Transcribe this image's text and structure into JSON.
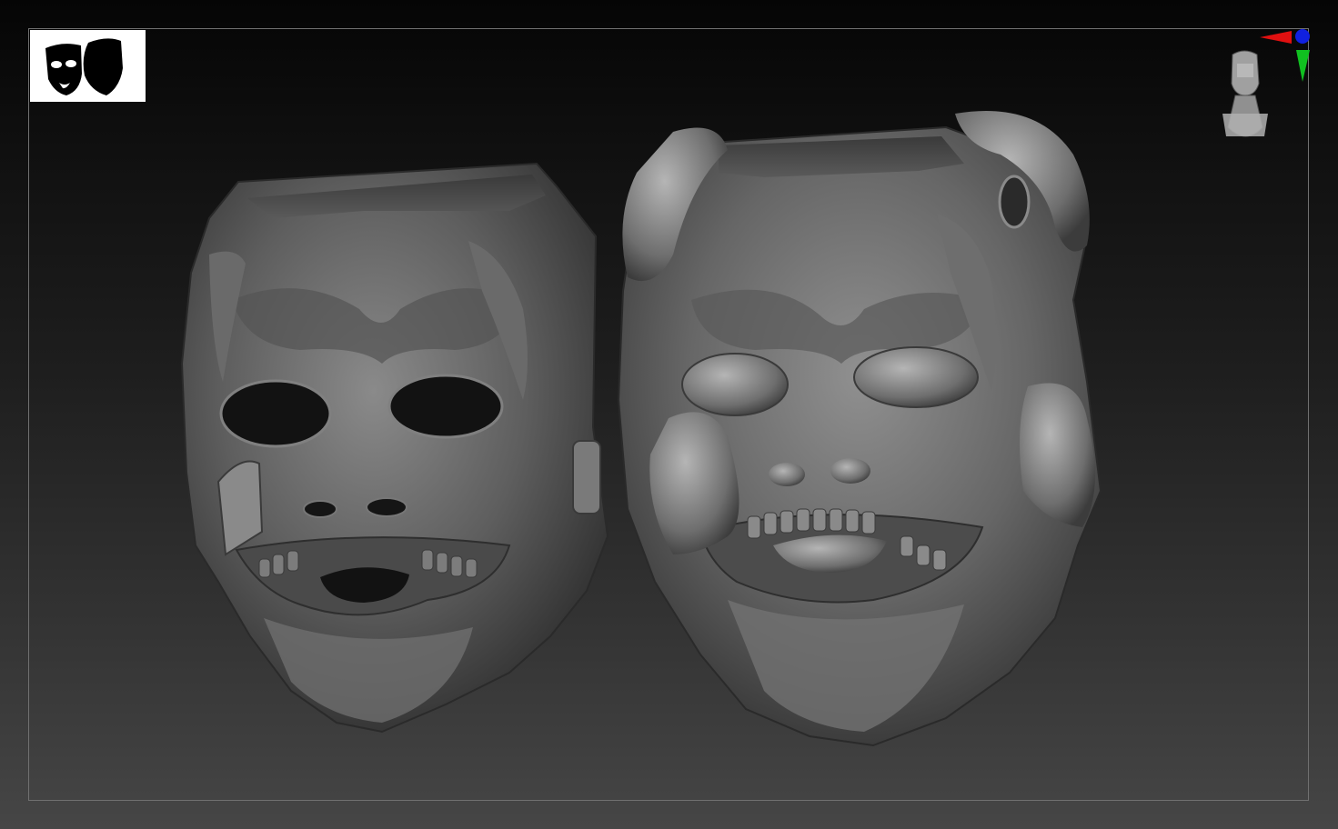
{
  "app": {
    "window_title": ""
  },
  "viewport": {
    "background_top": "#050505",
    "background_bottom": "#464646",
    "frame_color": "#707070"
  },
  "thumbnail": {
    "icon": "theatre-masks-icon",
    "background": "#ffffff",
    "foreground": "#000000"
  },
  "navigation_gizmo": {
    "icon": "head-orientation-icon",
    "x_axis_color": "#e01010",
    "y_axis_color": "#10c020",
    "z_axis_color": "#1020e0"
  },
  "models": [
    {
      "name": "mask-left",
      "description_icon": "tragedy-mask-icon"
    },
    {
      "name": "mask-right",
      "description_icon": "comedy-mask-icon"
    }
  ]
}
